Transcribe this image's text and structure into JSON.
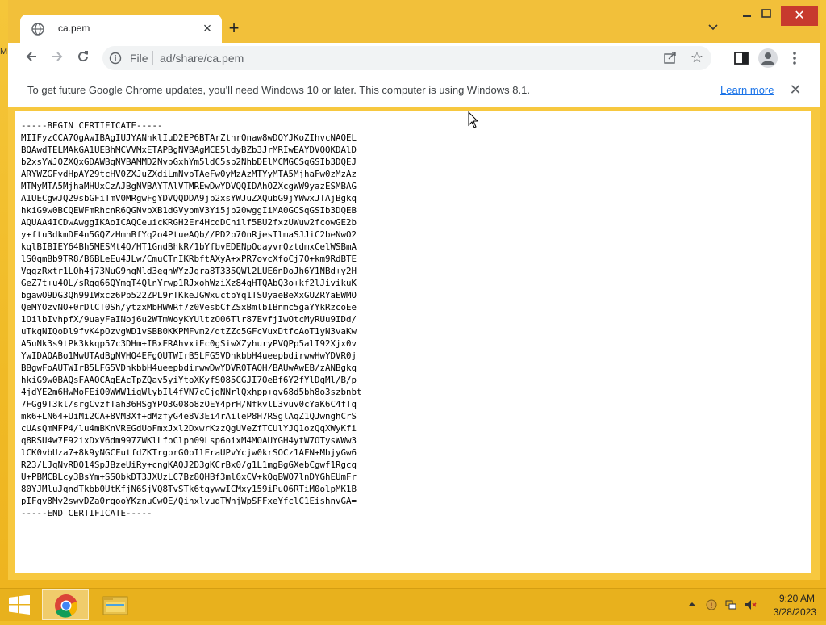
{
  "desktop": {
    "edge_label": "M"
  },
  "browser": {
    "tab": {
      "title": "ca.pem"
    },
    "omnibox": {
      "scheme": "File",
      "url": "ad/share/ca.pem"
    },
    "infobar": {
      "message": "To get future Google Chrome updates, you'll need Windows 10 or later. This computer is using Windows 8.1.",
      "link": "Learn more"
    },
    "content_lines": [
      "-----BEGIN CERTIFICATE-----",
      "MIIFyzCCA7OgAwIBAgIUJYANnklIuD2EP6BTArZthrQnaw8wDQYJKoZIhvcNAQEL",
      "BQAwdTELMAkGA1UEBhMCVVMxETAPBgNVBAgMCE5ldyBZb3JrMRIwEAYDVQQKDAlD",
      "b2xsYWJOZXQxGDAWBgNVBAMMD2NvbGxhYm5ldC5sb2NhbDElMCMGCSqGSIb3DQEJ",
      "ARYWZGFydHpAY29tcHV0ZXJuZXdiLmNvbTAeFw0yMzAzMTYyMTA5MjhaFw0zMzAz",
      "MTMyMTA5MjhaMHUxCzAJBgNVBAYTAlVTMREwDwYDVQQIDAhOZXcgWW9yazESMBAG",
      "A1UECgwJQ29sbGFiTmV0MRgwFgYDVQQDDA9jb2xsYWJuZXQubG9jYWwxJTAjBgkq",
      "hkiG9w0BCQEWFmRhcnR6QGNvbXB1dGVybmV3Yi5jb20wggIiMA0GCSqGSIb3DQEB",
      "AQUAA4ICDwAwggIKAoICAQCeuicKRGH2Er4HcdDCnilf5BU2fxzUWuw2fcowGE2b",
      "y+ftu3dkmDF4n5GQZzHmhBfYq2o4PtueAQb//PD2b70nRjesIlmaSJJiC2beNwO2",
      "kqlBIBIEY64Bh5MESMt4Q/HT1GndBhkR/1bYfbvEDENpOdayvrQztdmxCelWSBmA",
      "lS0qmBb9TR8/B6BLeEu4JLw/CmuCTnIKRbftAXyA+xPR7ovcXfoCj7O+km9RdBTE",
      "VqgzRxtr1LOh4j73NuG9ngNld3egnWYzJgra8T335QWl2LUE6nDoJh6Y1NBd+y2H",
      "GeZ7t+u4OL/sRqg66QYmqT4QlnYrwp1RJxohWziXz84qHTQAbQ3o+kf2lJivikuK",
      "bgawO9DG3Qh99IWxcz6Pb522ZPL9rTKkeJGWxuctbYq1TSUyaeBeXxGUZRYaEWMO",
      "QeMYOzvNO+0rDlCT0Sh/ytzxMbHWWRf7z0VesbCfZSxBmlbIBnmc5gaYYkRzcoEe",
      "1OilbIvhpfX/9uayFaINoj6u2WTmWoyKYUltzO06Tlr87EvfjIwOtcMyRUu9IDd/",
      "uTkqNIQoDl9fvK4pOzvgWD1vSBB0KKPMFvm2/dtZZc5GFcVuxDtfcAoT1yN3vaKw",
      "A5uNk3s9tPk3kkqp57c3DHm+IBxERAhvxiEc0gSiwXZyhuryPVQPp5alI92Xjx0v",
      "YwIDAQABo1MwUTAdBgNVHQ4EFgQUTWIrB5LFG5VDnkbbH4ueepbdirwwHwYDVR0j",
      "BBgwFoAUTWIrB5LFG5VDnkbbH4ueepbdirwwDwYDVR0TAQH/BAUwAwEB/zANBgkq",
      "hkiG9w0BAQsFAAOCAgEAcTpZQav5yiYtoXKyfS085CGJI7OeBf6Y2fYlDqMl/B/p",
      "4jdYE2m6HwMoFEiO0WWW1igWlybIl4fVN7cCjgNNrlQxhpp+qv68d5bh8o3szbnbt",
      "7FGg9T3kl/srgCvzfTah36HSgYPO3G08o8zOEY4prH/NfkvlL3vuv0cYaK6C4fTq",
      "mk6+LN64+UiMi2CA+8VM3Xf+dMzfyG4e8V3Ei4rAileP8H7RSglAqZ1QJwnghCrS",
      "cUAsQmMFP4/lu4mBKnVREGdUoFmxJxl2DxwrKzzQgUVeZfTCUlYJQ1ozQqXWyKfi",
      "q8RSU4w7E92ixDxV6dm997ZWKlLfpClpn09Lsp6oixM4MOAUYGH4ytW7OTysWWw3",
      "lCK0vbUza7+8k9yNGCFutfdZKTrgprG0bIlFraUPvYcjw0krSOCz1AFN+MbjyGw6",
      "R23/LJqNvRDO14SpJBzeUiRy+cngKAQJ2D3gKCrBx0/g1L1mgBgGXebCgwf1Rgcq",
      "U+PBMCBLcy3BsYm+SSQbkDT3JXUzLC7Bz8QHBf3ml6xCV+kQqBWO7lnDYGhEUmFr",
      "80YJMluJqndTkbb0UtKfjN6SjVQ8TvSTk6tqywwICMxy159iPuO6RTiM0olpMK1B",
      "pIFgv8My2swvDZa0rgooYKznuCwOE/QihxlvudTWhjWpSFFxeYfclC1EishnvGA=",
      "-----END CERTIFICATE-----"
    ]
  },
  "taskbar": {
    "apps": [
      {
        "name": "chrome-taskbar-button",
        "icon": "chrome-icon"
      },
      {
        "name": "file-explorer-taskbar-button",
        "icon": "folder-icon"
      }
    ],
    "clock": {
      "time": "9:20 AM",
      "date": "3/28/2023"
    }
  },
  "colors": {
    "desktop": "#f0be2a",
    "taskbar": "#e8b11d",
    "window_close": "#c73a2e",
    "link": "#1a73e8"
  }
}
